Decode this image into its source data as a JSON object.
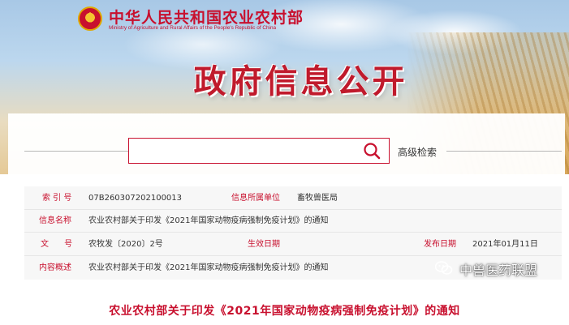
{
  "header": {
    "ministry_cn": "中华人民共和国农业农村部",
    "ministry_en": "Ministry of Agriculture and Rural Affairs of the People's Republic of China",
    "page_title": "政府信息公开"
  },
  "search": {
    "placeholder": "",
    "value": "",
    "advanced_label": "高级检索"
  },
  "info": {
    "index_label": "索 引 号",
    "index_value": "07B260307202100013",
    "unit_label": "信息所属单位",
    "unit_value": "畜牧兽医局",
    "name_label": "信息名称",
    "name_value": "农业农村部关于印发《2021年国家动物疫病强制免疫计划》的通知",
    "doc_label": "文      号",
    "doc_value": "农牧发〔2020〕2号",
    "effective_label": "生效日期",
    "effective_value": "",
    "issue_label": "发布日期",
    "issue_value": "2021年01月11日",
    "summary_label": "内容概述",
    "summary_value": "农业农村部关于印发《2021年国家动物疫病强制免疫计划》的通知"
  },
  "watermark": {
    "text": "中兽医药联盟"
  },
  "headline": "农业农村部关于印发《2021年国家动物疫病强制免疫计划》的通知",
  "colors": {
    "brand_red": "#c8102e",
    "label_red": "#c8102e",
    "text": "#333333"
  }
}
